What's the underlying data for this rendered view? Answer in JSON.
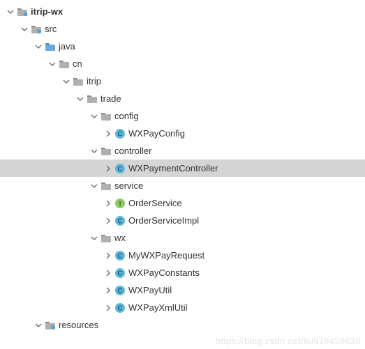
{
  "watermark": "https://blog.csdn.net/liu918458630",
  "tree": {
    "root": {
      "label": "itrip-wx",
      "expanded": true,
      "children": [
        {
          "label": "src",
          "icon": "src",
          "expanded": true,
          "children": [
            {
              "label": "java",
              "icon": "folder-blue",
              "expanded": true,
              "children": [
                {
                  "label": "cn",
                  "icon": "folder",
                  "expanded": true,
                  "children": [
                    {
                      "label": "itrip",
                      "icon": "folder",
                      "expanded": true,
                      "children": [
                        {
                          "label": "trade",
                          "icon": "folder",
                          "expanded": true,
                          "children": [
                            {
                              "label": "config",
                              "icon": "folder",
                              "expanded": true,
                              "children": [
                                {
                                  "label": "WXPayConfig",
                                  "icon": "class",
                                  "expanded": false
                                }
                              ]
                            },
                            {
                              "label": "controller",
                              "icon": "folder",
                              "expanded": true,
                              "children": [
                                {
                                  "label": "WXPaymentController",
                                  "icon": "class",
                                  "expanded": false,
                                  "selected": true
                                }
                              ]
                            },
                            {
                              "label": "service",
                              "icon": "folder",
                              "expanded": true,
                              "children": [
                                {
                                  "label": "OrderService",
                                  "icon": "interface",
                                  "expanded": false
                                },
                                {
                                  "label": "OrderServiceImpl",
                                  "icon": "class",
                                  "expanded": false
                                }
                              ]
                            },
                            {
                              "label": "wx",
                              "icon": "folder",
                              "expanded": true,
                              "children": [
                                {
                                  "label": "MyWXPayRequest",
                                  "icon": "class",
                                  "expanded": false
                                },
                                {
                                  "label": "WXPayConstants",
                                  "icon": "class",
                                  "expanded": false
                                },
                                {
                                  "label": "WXPayUtil",
                                  "icon": "class",
                                  "expanded": false
                                },
                                {
                                  "label": "WXPayXmlUtil",
                                  "icon": "class",
                                  "expanded": false
                                }
                              ]
                            }
                          ]
                        }
                      ]
                    }
                  ]
                }
              ]
            },
            {
              "label": "resources",
              "icon": "src",
              "expanded": true,
              "children": []
            }
          ]
        }
      ]
    }
  }
}
